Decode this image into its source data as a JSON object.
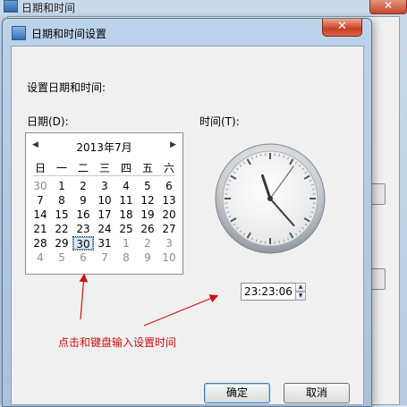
{
  "background_window": {
    "title": "日期和时间"
  },
  "dialog": {
    "title": "日期和时间设置",
    "close_glyph": "✕",
    "instruction": "设置日期和时间:",
    "date_label": "日期(D):",
    "time_label": "时间(T):",
    "ok_label": "确定",
    "cancel_label": "取消",
    "annotation": "点击和键盘输入设置时间",
    "annotation_color": "#d21010"
  },
  "calendar": {
    "month_title": "2013年7月",
    "prev_glyph": "◀",
    "next_glyph": "▶",
    "weekdays": [
      "日",
      "一",
      "二",
      "三",
      "四",
      "五",
      "六"
    ],
    "weeks": [
      [
        {
          "d": "30",
          "o": true
        },
        {
          "d": "1"
        },
        {
          "d": "2"
        },
        {
          "d": "3"
        },
        {
          "d": "4"
        },
        {
          "d": "5"
        },
        {
          "d": "6"
        }
      ],
      [
        {
          "d": "7"
        },
        {
          "d": "8"
        },
        {
          "d": "9"
        },
        {
          "d": "10"
        },
        {
          "d": "11"
        },
        {
          "d": "12"
        },
        {
          "d": "13"
        }
      ],
      [
        {
          "d": "14"
        },
        {
          "d": "15"
        },
        {
          "d": "16"
        },
        {
          "d": "17"
        },
        {
          "d": "18"
        },
        {
          "d": "19"
        },
        {
          "d": "20"
        }
      ],
      [
        {
          "d": "21"
        },
        {
          "d": "22"
        },
        {
          "d": "23"
        },
        {
          "d": "24"
        },
        {
          "d": "25"
        },
        {
          "d": "26"
        },
        {
          "d": "27"
        }
      ],
      [
        {
          "d": "28"
        },
        {
          "d": "29"
        },
        {
          "d": "30",
          "sel": true
        },
        {
          "d": "31"
        },
        {
          "d": "1",
          "o": true
        },
        {
          "d": "2",
          "o": true
        },
        {
          "d": "3",
          "o": true
        }
      ],
      [
        {
          "d": "4",
          "o": true
        },
        {
          "d": "5",
          "o": true
        },
        {
          "d": "6",
          "o": true
        },
        {
          "d": "7",
          "o": true
        },
        {
          "d": "8",
          "o": true
        },
        {
          "d": "9",
          "o": true
        },
        {
          "d": "10",
          "o": true
        }
      ]
    ]
  },
  "time": {
    "value": "23:23:06",
    "hour": 23,
    "minute": 23,
    "second": 6
  }
}
